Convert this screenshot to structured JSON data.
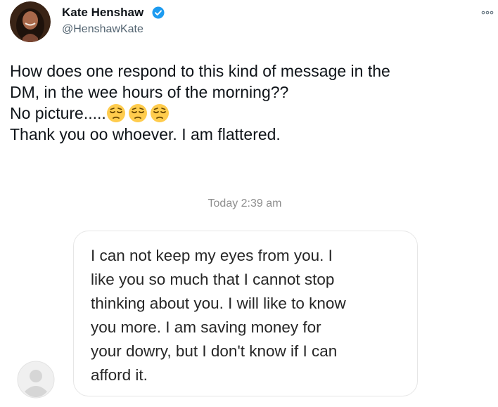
{
  "author": {
    "display_name": "Kate Henshaw",
    "handle": "@HenshawKate",
    "verified": true
  },
  "tweet": {
    "lines": [
      "How does one respond to this kind of message in the",
      "DM, in the wee hours of the morning??",
      "No picture.....",
      "Thank you oo whoever. I am flattered."
    ],
    "emoji_count": 3
  },
  "dm": {
    "timestamp": "Today 2:39 am",
    "message_lines": [
      "I can not keep my eyes from you. I",
      "like you so much that I cannot stop",
      "thinking about you. I will like to know",
      "you more. I am saving money for",
      "your dowry, but I don't know if I can",
      "afford it."
    ]
  },
  "colors": {
    "verified_badge": "#1d9bf0",
    "handle": "#536471",
    "timestamp": "#8e8e8e",
    "emoji_face": "#ffcc4d"
  }
}
